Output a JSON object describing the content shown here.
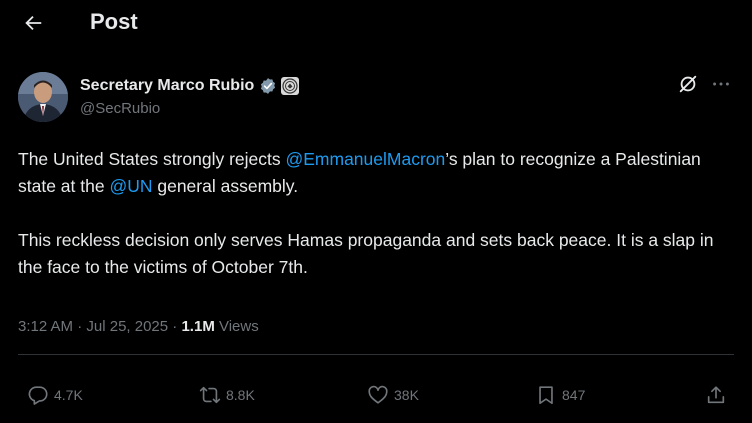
{
  "header": {
    "title": "Post"
  },
  "author": {
    "display_name": "Secretary Marco Rubio",
    "handle": "@SecRubio"
  },
  "tweet": {
    "line1_pre": "The United States strongly rejects ",
    "mention_macron": "@EmmanuelMacron",
    "line1_post": "’s plan to recognize a Palestinian state at the ",
    "mention_un": "@UN",
    "line1_end": " general assembly.",
    "paragraph2": "This reckless decision only serves Hamas propaganda and sets back peace. It is a slap in the face to the victims of October 7th."
  },
  "meta": {
    "time": "3:12 AM",
    "separator1": " · ",
    "date": "Jul 25, 2025",
    "separator2": " · ",
    "views_count": "1.1M",
    "views_label": " Views"
  },
  "actions": {
    "replies": "4.7K",
    "reposts": "8.8K",
    "likes": "38K",
    "bookmarks": "847"
  },
  "colors": {
    "background": "#000000",
    "text": "#e7e9ea",
    "muted": "#71767b",
    "link": "#1d9bf0",
    "verified_badge": "#829aab"
  }
}
